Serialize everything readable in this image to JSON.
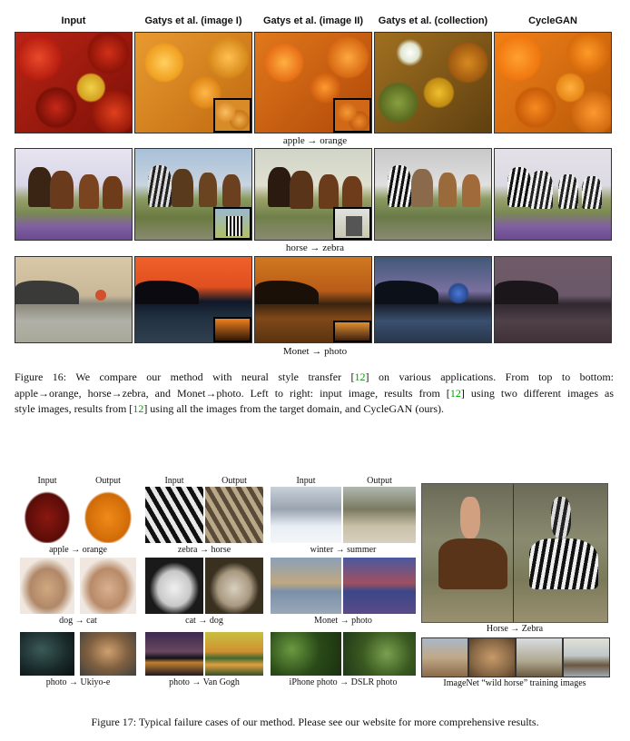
{
  "fig16": {
    "headers": [
      "Input",
      "Gatys et al. (image I)",
      "Gatys et al. (image II)",
      "Gatys et al. (collection)",
      "CycleGAN"
    ],
    "row_labels": [
      "apple → orange",
      "horse  → zebra",
      "Monet → photo"
    ],
    "caption_lines": [
      {
        "pre": "Figure 16:  We compare our method with neural style transfer [",
        "ref": "12",
        "post": "] on various applications.   From top to bottom:"
      },
      {
        "pre": "apple→orange, horse→zebra, and Monet→photo. Left to right: input image, results from [",
        "ref": "12",
        "post": "] using two different images as"
      },
      {
        "pre": "style images, results from [",
        "ref": "12",
        "post": "] using all the images from the target domain, and CycleGAN (ours)."
      }
    ]
  },
  "fig17": {
    "input_label": "Input",
    "output_label": "Output",
    "pair_labels": {
      "apple_orange": "apple → orange",
      "zebra_horse": "zebra → horse",
      "winter_summer": "winter → summer",
      "dog_cat": "dog → cat",
      "cat_dog": "cat → dog",
      "monet_photo": "Monet → photo",
      "photo_ukiyoe": "photo → Ukiyo-e",
      "photo_vangogh": "photo → Van Gogh",
      "iphone_dslr": "iPhone photo → DSLR photo"
    },
    "horse_zebra_label": "Horse → Zebra",
    "imagenet_label": "ImageNet “wild horse” training images",
    "caption": "Figure 17: Typical failure cases of our method. Please see our website for more comprehensive results."
  },
  "colors": {
    "reference_link": "#00a000",
    "border": "#333333"
  }
}
